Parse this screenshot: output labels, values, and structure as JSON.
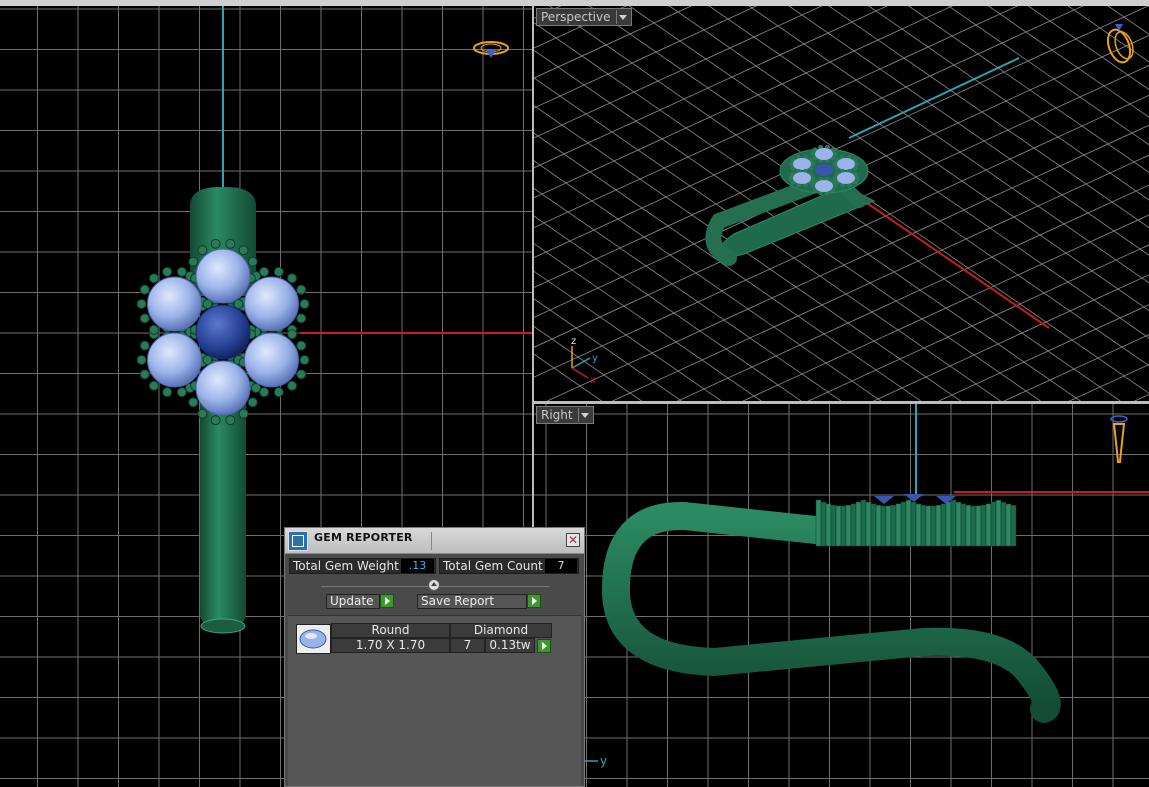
{
  "viewports": {
    "perspective": {
      "label": "Perspective",
      "axes": {
        "z": "z",
        "y": "y",
        "x": "x"
      }
    },
    "right": {
      "label": "Right",
      "axis_y": "y"
    }
  },
  "gem_reporter": {
    "title": "GEM REPORTER",
    "close_symbol": "✕",
    "total_gem_weight_label": "Total Gem Weight",
    "total_gem_weight_value": ".13",
    "total_gem_count_label": "Total Gem Count",
    "total_gem_count_value": "7",
    "update_label": "Update",
    "save_report_label": "Save Report",
    "rows": [
      {
        "cut": "Round",
        "size": "1.70 X 1.70",
        "material": "Diamond",
        "count": "7",
        "weight": "0.13tw",
        "icon": "round-gem-icon"
      }
    ]
  },
  "colors": {
    "metal": "#1f6a4c",
    "gem": "#9bb3e8",
    "center_gem": "#243f93",
    "axis_red": "#c81e1e",
    "axis_cyan": "#2aa6b8",
    "grid": "#8a8a8a",
    "view_cube": "#e9a21a"
  }
}
